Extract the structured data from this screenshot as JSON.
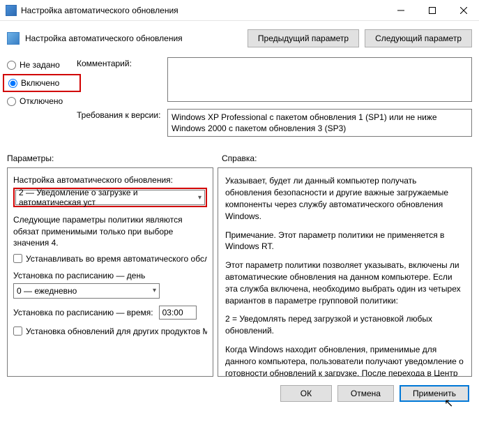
{
  "titlebar": {
    "title": "Настройка автоматического обновления"
  },
  "header": {
    "title": "Настройка автоматического обновления",
    "prev_btn": "Предыдущий параметр",
    "next_btn": "Следующий параметр"
  },
  "radios": {
    "not_configured": "Не задано",
    "enabled": "Включено",
    "disabled": "Отключено",
    "selected": "enabled"
  },
  "fields": {
    "comment_label": "Комментарий:",
    "comment_value": "",
    "reqs_label": "Требования к версии:",
    "reqs_value": "Windows XP Professional с пакетом обновления 1 (SP1) или не ниже Windows 2000 с пакетом обновления 3 (SP3)"
  },
  "sections": {
    "params_label": "Параметры:",
    "help_label": "Справка:"
  },
  "params": {
    "opt_label": "Настройка автоматического обновления:",
    "opt_selected": "2 — Уведомление о загрузке и автоматическая уст",
    "hint": "Следующие параметры политики являются обязат применимыми только при выборе значения 4.",
    "chk_maint": "Устанавливать во время автоматического обслу",
    "sched_day_label": "Установка по расписанию — день",
    "sched_day_value": "0 — ежедневно",
    "sched_time_label": "Установка по расписанию — время:",
    "sched_time_value": "03:00",
    "chk_other": "Установка обновлений для других продуктов М"
  },
  "help": {
    "p1": "Указывает, будет ли данный компьютер получать обновления безопасности и другие важные загружаемые компоненты через службу автоматического обновления Windows.",
    "p2": "Примечание. Этот параметр политики не применяется в Windows RT.",
    "p3": "Этот параметр политики позволяет указывать, включены ли автоматические обновления на данном компьютере. Если эта служба включена, необходимо выбрать один из четырех вариантов в параметре групповой политики:",
    "p4": "        2 = Уведомлять перед загрузкой и установкой любых обновлений.",
    "p5": "        Когда Windows находит обновления, применимые для данного компьютера, пользователи получают уведомление о готовности обновлений к загрузке. После перехода в Центр обновления Windows пользователи могут загрузить и"
  },
  "footer": {
    "ok": "ОК",
    "cancel": "Отмена",
    "apply": "Применить"
  }
}
